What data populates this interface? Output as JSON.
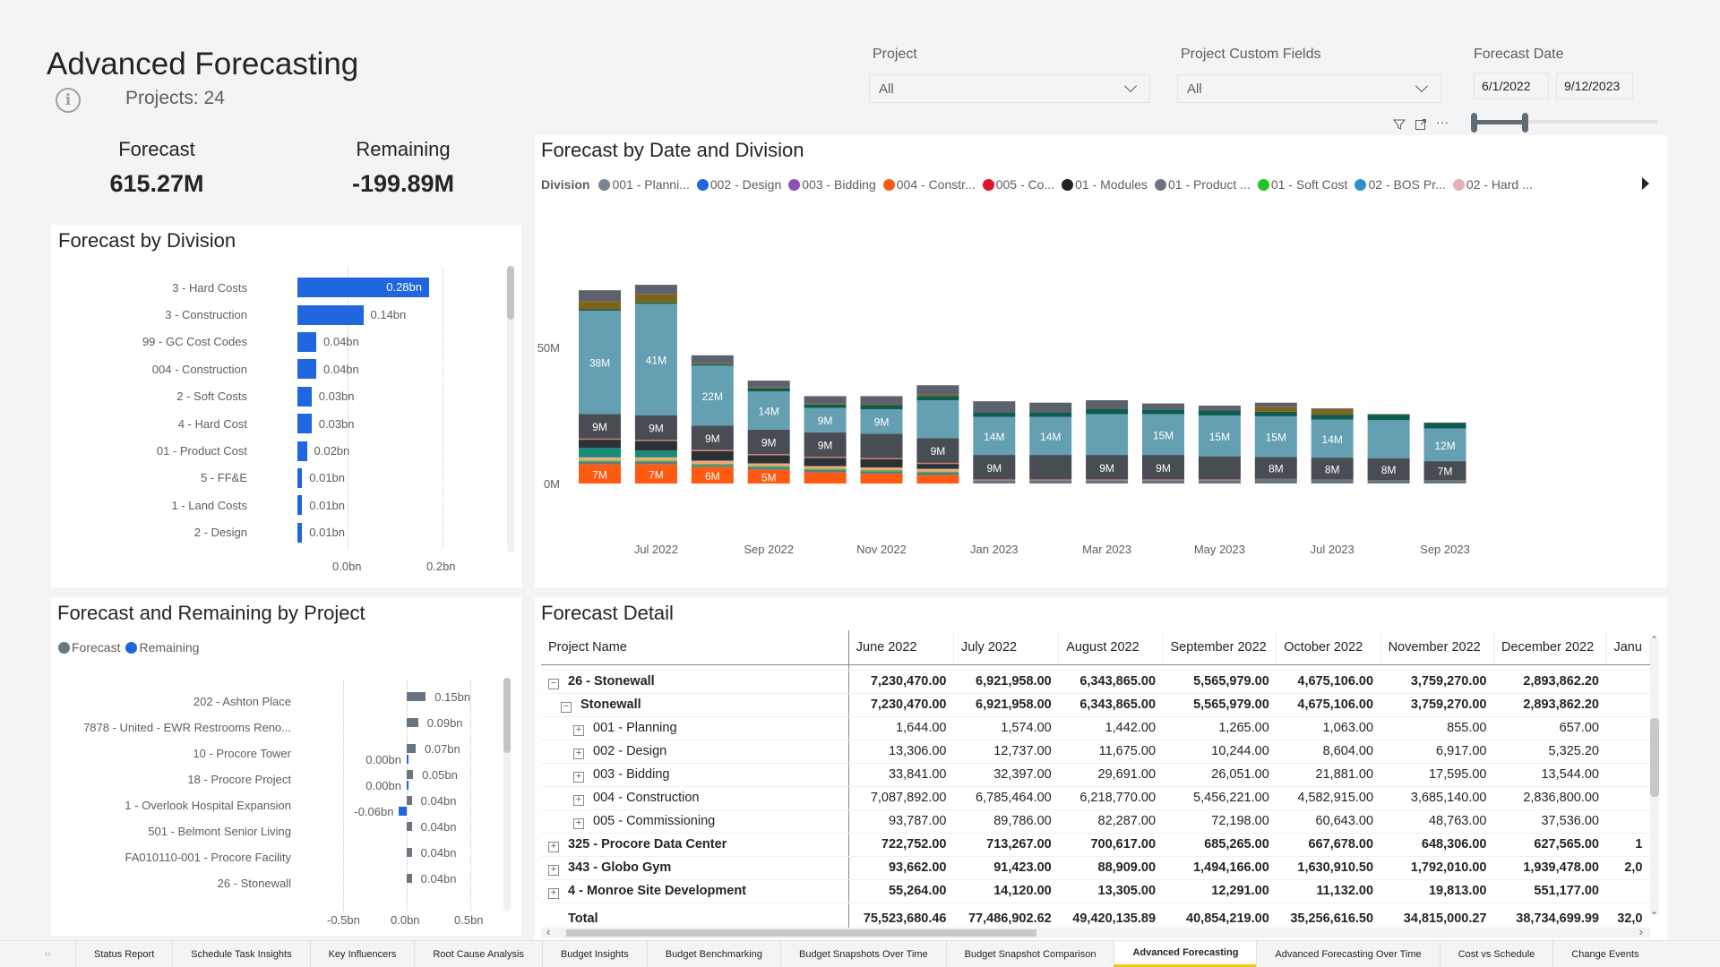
{
  "header": {
    "title": "Advanced Forecasting",
    "info_icon": "info-icon",
    "projects_count": "Projects: 24"
  },
  "kpis": {
    "forecast_label": "Forecast",
    "forecast_value": "615.27M",
    "remaining_label": "Remaining",
    "remaining_value": "-199.89M"
  },
  "filters": {
    "project_label": "Project",
    "project_value": "All",
    "custom_fields_label": "Project Custom Fields",
    "custom_fields_value": "All",
    "forecast_date_label": "Forecast Date",
    "date_start": "6/1/2022",
    "date_end": "9/12/2023",
    "date_range_selected_fraction": [
      0.0,
      0.28
    ]
  },
  "visual_header_icons": [
    "filter-icon",
    "focus-mode-icon",
    "more-options-icon"
  ],
  "chart_data": [
    {
      "id": "forecast_by_division",
      "type": "bar",
      "orientation": "horizontal",
      "title": "Forecast by Division",
      "categories": [
        "3 - Hard Costs",
        "3 - Construction",
        "99 - GC Cost Codes",
        "004 - Construction",
        "2 - Soft Costs",
        "4 - Hard Cost",
        "01 - Product Cost",
        "5 - FF&E",
        "1 - Land Costs",
        "2 - Design"
      ],
      "values": [
        0.28,
        0.14,
        0.04,
        0.04,
        0.03,
        0.03,
        0.02,
        0.01,
        0.01,
        0.01
      ],
      "value_labels": [
        "0.28bn",
        "0.14bn",
        "0.04bn",
        "0.04bn",
        "0.03bn",
        "0.03bn",
        "0.02bn",
        "0.01bn",
        "0.01bn",
        "0.01bn"
      ],
      "xlim": [
        0,
        0.28
      ],
      "xticks": [
        "0.0bn",
        "0.2bn"
      ],
      "xtick_values": [
        0,
        0.2
      ],
      "color": "#1f66e0",
      "grid": true
    },
    {
      "id": "forecast_by_date_division",
      "type": "bar",
      "stacked": true,
      "title": "Forecast by Date and Division",
      "legend_title": "Division",
      "legend": [
        {
          "name": "001 - Planni...",
          "color": "#7a8591"
        },
        {
          "name": "002 - Design",
          "color": "#1f66e0"
        },
        {
          "name": "003 - Bidding",
          "color": "#8e4fb8"
        },
        {
          "name": "004  - Constr...",
          "color": "#ff5a12"
        },
        {
          "name": "005  - Co...",
          "color": "#e3122b"
        },
        {
          "name": "01 - Modules",
          "color": "#222222"
        },
        {
          "name": "01 - Product ...",
          "color": "#6b7580"
        },
        {
          "name": "01 - Soft Cost",
          "color": "#21c421"
        },
        {
          "name": "02 - BOS Pr...",
          "color": "#2b93c4"
        },
        {
          "name": "02 - Hard ...",
          "color": "#e6b1b5"
        }
      ],
      "legend_placement": "top",
      "categories": [
        "Jun 2022",
        "Jul 2022",
        "Aug 2022",
        "Sep 2022",
        "Oct 2022",
        "Nov 2022",
        "Dec 2022",
        "Jan 2023",
        "Feb 2023",
        "Mar 2023",
        "Apr 2023",
        "May 2023",
        "Jun 2023",
        "Jul 2023",
        "Aug 2023",
        "Sep 2023"
      ],
      "xtick_labels": [
        "Jul 2022",
        "Sep 2022",
        "Nov 2022",
        "Jan 2023",
        "Mar 2023",
        "May 2023",
        "Jul 2023",
        "Sep 2023"
      ],
      "yticks": [
        "0M",
        "50M"
      ],
      "ytick_values": [
        0,
        50
      ],
      "ylim": [
        0,
        80
      ],
      "segment_order": [
        {
          "name": "Orange division",
          "color": "#ff5a12"
        },
        {
          "name": "Gray 1",
          "color": "#6b7580"
        },
        {
          "name": "Green",
          "color": "#21c421"
        },
        {
          "name": "Peach",
          "color": "#f4a582"
        },
        {
          "name": "Teal",
          "color": "#178a7a"
        },
        {
          "name": "Near-black",
          "color": "#2b3236"
        },
        {
          "name": "Pink line",
          "color": "#e07b73"
        },
        {
          "name": "Dark gray",
          "color": "#474d52"
        },
        {
          "name": "Light blue",
          "color": "#659fb2"
        },
        {
          "name": "Dark green",
          "color": "#0d5c4f"
        },
        {
          "name": "Olive",
          "color": "#7d6418"
        },
        {
          "name": "Top gray",
          "color": "#5d616c"
        }
      ],
      "series_values": [
        [
          7,
          1,
          0.4,
          1.2,
          3.5,
          3,
          0.4,
          9,
          38,
          0.5,
          3,
          4
        ],
        [
          7,
          1,
          0.4,
          1.2,
          2.5,
          3.5,
          0.4,
          9,
          41,
          0.5,
          3,
          3.5
        ],
        [
          6,
          0.8,
          0.4,
          1.2,
          0,
          3.5,
          0.4,
          9,
          22,
          0.5,
          0.3,
          3
        ],
        [
          5,
          1,
          0.4,
          1,
          0,
          3,
          0.4,
          9,
          14,
          1.2,
          0.3,
          2.5
        ],
        [
          4,
          1,
          0.4,
          1,
          0,
          3,
          0.4,
          9,
          9,
          1.2,
          0.3,
          2.8
        ],
        [
          3.5,
          1,
          0.4,
          1,
          0,
          3,
          0.4,
          9,
          9,
          1.5,
          0.3,
          3
        ],
        [
          3,
          1,
          0.4,
          1,
          0,
          1.8,
          0.4,
          9,
          14,
          1.5,
          0.5,
          3.5
        ],
        [
          0,
          1.2,
          0,
          0,
          0,
          0,
          0.3,
          9,
          14,
          1.7,
          0,
          4
        ],
        [
          0,
          1.2,
          0,
          0,
          0,
          0,
          0.3,
          9,
          14,
          1.7,
          0,
          3.5
        ],
        [
          0,
          1.2,
          0,
          0,
          0,
          0,
          0.3,
          9,
          15,
          1.8,
          0,
          3.3
        ],
        [
          0,
          1.2,
          0,
          0,
          0,
          0,
          0.3,
          9,
          15,
          1.7,
          0,
          2.2
        ],
        [
          0,
          1.2,
          0,
          0,
          0,
          0,
          0.3,
          8.5,
          15,
          1.8,
          0,
          1.8
        ],
        [
          0,
          1.7,
          0,
          0,
          0,
          0,
          0,
          8,
          15,
          1.7,
          1.8,
          1.5
        ],
        [
          0,
          1.5,
          0,
          0,
          0,
          0,
          0,
          8,
          14,
          1.8,
          2.0,
          0.3
        ],
        [
          0,
          1.3,
          0,
          0,
          0,
          0,
          0,
          8,
          14,
          2.0,
          0,
          0.2
        ],
        [
          0,
          1.2,
          0,
          0,
          0,
          0,
          0,
          7,
          12,
          2.0,
          0,
          0.2
        ]
      ],
      "data_labels": [
        {
          "bar": 0,
          "segment": 0,
          "text": "7M"
        },
        {
          "bar": 0,
          "segment": 7,
          "text": "9M"
        },
        {
          "bar": 0,
          "segment": 8,
          "text": "38M"
        },
        {
          "bar": 1,
          "segment": 0,
          "text": "7M"
        },
        {
          "bar": 1,
          "segment": 7,
          "text": "9M"
        },
        {
          "bar": 1,
          "segment": 8,
          "text": "41M"
        },
        {
          "bar": 2,
          "segment": 0,
          "text": "6M"
        },
        {
          "bar": 2,
          "segment": 7,
          "text": "9M"
        },
        {
          "bar": 2,
          "segment": 8,
          "text": "22M"
        },
        {
          "bar": 3,
          "segment": 0,
          "text": "5M"
        },
        {
          "bar": 3,
          "segment": 7,
          "text": "9M"
        },
        {
          "bar": 3,
          "segment": 8,
          "text": "14M"
        },
        {
          "bar": 4,
          "segment": 7,
          "text": "9M"
        },
        {
          "bar": 4,
          "segment": 8,
          "text": "9M"
        },
        {
          "bar": 5,
          "segment": 8,
          "text": "9M"
        },
        {
          "bar": 6,
          "segment": 7,
          "text": "9M"
        },
        {
          "bar": 7,
          "segment": 7,
          "text": "9M"
        },
        {
          "bar": 7,
          "segment": 8,
          "text": "14M"
        },
        {
          "bar": 8,
          "segment": 8,
          "text": "14M"
        },
        {
          "bar": 9,
          "segment": 7,
          "text": "9M"
        },
        {
          "bar": 10,
          "segment": 7,
          "text": "9M"
        },
        {
          "bar": 10,
          "segment": 8,
          "text": "15M"
        },
        {
          "bar": 11,
          "segment": 8,
          "text": "15M"
        },
        {
          "bar": 12,
          "segment": 7,
          "text": "8M"
        },
        {
          "bar": 12,
          "segment": 8,
          "text": "15M"
        },
        {
          "bar": 13,
          "segment": 7,
          "text": "8M"
        },
        {
          "bar": 13,
          "segment": 8,
          "text": "14M"
        },
        {
          "bar": 14,
          "segment": 7,
          "text": "8M"
        },
        {
          "bar": 15,
          "segment": 7,
          "text": "7M"
        },
        {
          "bar": 15,
          "segment": 8,
          "text": "12M"
        }
      ]
    },
    {
      "id": "forecast_remaining_by_project",
      "type": "bar",
      "orientation": "horizontal",
      "title": "Forecast and Remaining by Project",
      "legend": [
        {
          "name": "Forecast",
          "color": "#6b7580"
        },
        {
          "name": "Remaining",
          "color": "#1f66e0"
        }
      ],
      "legend_placement": "top-left",
      "categories": [
        "202 - Ashton Place",
        "7878 - United - EWR Restrooms Reno...",
        "10 - Procore Tower",
        "18 - Procore Project",
        "1 - Overlook Hospital Expansion",
        "501 - Belmont Senior Living",
        "FA010110-001 - Procore Facility",
        "26 - Stonewall"
      ],
      "series": [
        {
          "name": "Forecast",
          "values": [
            0.15,
            0.09,
            0.07,
            0.05,
            0.04,
            0.04,
            0.04,
            0.04
          ],
          "labels": [
            "0.15bn",
            "0.09bn",
            "0.07bn",
            "0.05bn",
            "0.04bn",
            "0.04bn",
            "0.04bn",
            "0.04bn"
          ]
        },
        {
          "name": "Remaining",
          "values": [
            null,
            null,
            0.004,
            0.004,
            -0.06,
            null,
            null,
            null
          ],
          "labels": [
            "",
            "",
            "0.00bn",
            "0.00bn",
            "-0.06bn",
            "",
            "",
            ""
          ]
        }
      ],
      "xlim": [
        -0.5,
        0.5
      ],
      "xticks": [
        "-0.5bn",
        "0.0bn",
        "0.5bn"
      ],
      "xtick_values": [
        -0.5,
        0,
        0.5
      ],
      "grid": true
    }
  ],
  "division_panel": {
    "title": "Forecast by Division"
  },
  "date_division_panel": {
    "title": "Forecast by Date and Division",
    "legend_title": "Division"
  },
  "project_panel": {
    "title": "Forecast and Remaining by Project"
  },
  "detail": {
    "title": "Forecast Detail",
    "columns": [
      "Project Name",
      "June 2022",
      "July 2022",
      "August 2022",
      "September 2022",
      "October 2022",
      "November 2022",
      "December 2022",
      "Janu"
    ],
    "rows": [
      {
        "level": 0,
        "expander": "minus",
        "bold": true,
        "name": "26 - Stonewall",
        "values": [
          "7,230,470.00",
          "6,921,958.00",
          "6,343,865.00",
          "5,565,979.00",
          "4,675,106.00",
          "3,759,270.00",
          "2,893,862.20",
          ""
        ]
      },
      {
        "level": 1,
        "expander": "minus",
        "bold": true,
        "name": "Stonewall",
        "values": [
          "7,230,470.00",
          "6,921,958.00",
          "6,343,865.00",
          "5,565,979.00",
          "4,675,106.00",
          "3,759,270.00",
          "2,893,862.20",
          ""
        ]
      },
      {
        "level": 2,
        "expander": "plus",
        "bold": false,
        "name": "001 - Planning",
        "values": [
          "1,644.00",
          "1,574.00",
          "1,442.00",
          "1,265.00",
          "1,063.00",
          "855.00",
          "657.00",
          ""
        ]
      },
      {
        "level": 2,
        "expander": "plus",
        "bold": false,
        "name": "002 - Design",
        "values": [
          "13,306.00",
          "12,737.00",
          "11,675.00",
          "10,244.00",
          "8,604.00",
          "6,917.00",
          "5,325.20",
          ""
        ]
      },
      {
        "level": 2,
        "expander": "plus",
        "bold": false,
        "name": "003 - Bidding",
        "values": [
          "33,841.00",
          "32,397.00",
          "29,691.00",
          "26,051.00",
          "21,881.00",
          "17,595.00",
          "13,544.00",
          ""
        ]
      },
      {
        "level": 2,
        "expander": "plus",
        "bold": false,
        "name": "004 - Construction",
        "values": [
          "7,087,892.00",
          "6,785,464.00",
          "6,218,770.00",
          "5,456,221.00",
          "4,582,915.00",
          "3,685,140.00",
          "2,836,800.00",
          ""
        ]
      },
      {
        "level": 2,
        "expander": "plus",
        "bold": false,
        "name": "005 - Commissioning",
        "values": [
          "93,787.00",
          "89,786.00",
          "82,287.00",
          "72,198.00",
          "60,643.00",
          "48,763.00",
          "37,536.00",
          ""
        ]
      },
      {
        "level": 0,
        "expander": "plus",
        "bold": true,
        "name": "325 - Procore Data Center",
        "values": [
          "722,752.00",
          "713,267.00",
          "700,617.00",
          "685,265.00",
          "667,678.00",
          "648,306.00",
          "627,565.00",
          "1"
        ]
      },
      {
        "level": 0,
        "expander": "plus",
        "bold": true,
        "name": "343 - Globo Gym",
        "values": [
          "93,662.00",
          "91,423.00",
          "88,909.00",
          "1,494,166.00",
          "1,630,910.50",
          "1,792,010.00",
          "1,939,478.00",
          "2,0"
        ]
      },
      {
        "level": 0,
        "expander": "plus",
        "bold": true,
        "name": "4 - Monroe Site Development",
        "values": [
          "55,264.00",
          "14,120.00",
          "13,305.00",
          "12,291.00",
          "11,132.00",
          "19,813.00",
          "551,177.00",
          ""
        ]
      }
    ],
    "total": {
      "name": "Total",
      "values": [
        "75,523,680.46",
        "77,486,902.62",
        "49,420,135.89",
        "40,854,219.00",
        "35,256,616.50",
        "34,815,000.27",
        "38,734,699.99",
        "32,0"
      ]
    }
  },
  "tabs": {
    "items": [
      "Status Report",
      "Schedule Task Insights",
      "Key Influencers",
      "Root Cause Analysis",
      "Budget Insights",
      "Budget Benchmarking",
      "Budget Snapshots Over Time",
      "Budget Snapshot Comparison",
      "Advanced Forecasting",
      "Advanced Forecasting Over Time",
      "Cost vs Schedule",
      "Change Events"
    ],
    "active": "Advanced Forecasting",
    "accent_color": "#f2c811"
  }
}
